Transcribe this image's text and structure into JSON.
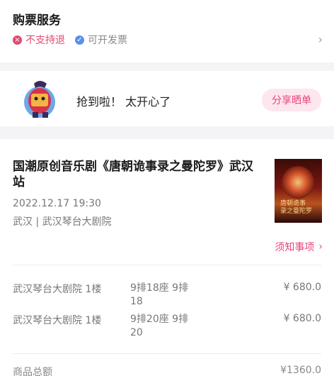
{
  "service": {
    "title": "购票服务",
    "no_refund": {
      "icon": "x-circle-icon",
      "label": "不支持退"
    },
    "invoice": {
      "icon": "check-circle-icon",
      "label": "可开发票"
    }
  },
  "share": {
    "message": "抢到啦！ 太开心了",
    "button": "分享晒单"
  },
  "order": {
    "title": "国潮原创音乐剧《唐朝诡事录之曼陀罗》武汉站",
    "datetime": "2022.12.17 19:30",
    "venue": "武汉 | 武汉琴台大剧院",
    "poster_text": "唐朝诡事录之曼陀罗",
    "notice": "须知事项",
    "tickets": [
      {
        "venue": "武汉琴台大剧院 1楼",
        "seat": "9排18座 9排18",
        "price": "¥ 680.0"
      },
      {
        "venue": "武汉琴台大剧院 1楼",
        "seat": "9排20座 9排20",
        "price": "¥ 680.0"
      }
    ],
    "total_label": "商品总额",
    "total_value": "¥1360.0"
  },
  "colors": {
    "accent": "#e8467a",
    "accent_bg": "#fde6ee",
    "invoice_blue": "#5a8ff0"
  }
}
